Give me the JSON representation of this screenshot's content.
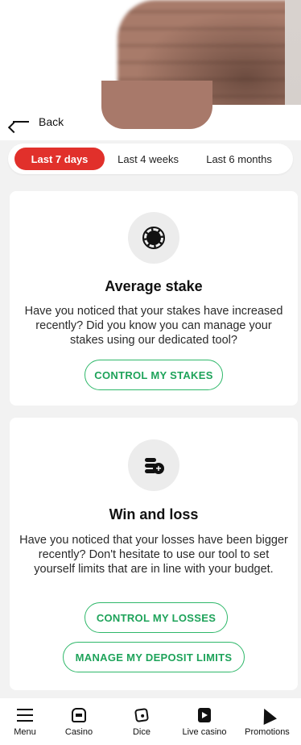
{
  "header": {
    "back_label": "Back"
  },
  "tabs": [
    {
      "label": "Last 7 days",
      "active": true
    },
    {
      "label": "Last 4 weeks",
      "active": false
    },
    {
      "label": "Last 6 months",
      "active": false
    }
  ],
  "cards": [
    {
      "icon": "poker-chip-icon",
      "title": "Average stake",
      "text": "Have you noticed that your stakes have increased recently? Did you know you can manage your stakes using our dedicated tool?",
      "buttons": [
        "CONTROL MY STAKES"
      ]
    },
    {
      "icon": "coins-add-icon",
      "title": "Win and loss",
      "text": "Have you noticed that your losses have been bigger recently? Don't hesitate to use our tool to set yourself limits that are in line with your budget.",
      "buttons": [
        "CONTROL MY LOSSES",
        "MANAGE MY DEPOSIT LIMITS"
      ]
    }
  ],
  "bottom_nav": [
    {
      "label": "Menu",
      "icon": "menu-icon"
    },
    {
      "label": "Casino",
      "icon": "slot-machine-icon"
    },
    {
      "label": "Dice",
      "icon": "dice-icon"
    },
    {
      "label": "Live casino",
      "icon": "live-casino-icon"
    },
    {
      "label": "Promotions",
      "icon": "promotions-icon"
    }
  ],
  "colors": {
    "accent_red": "#e1302b",
    "accent_green": "#2fb86a"
  }
}
